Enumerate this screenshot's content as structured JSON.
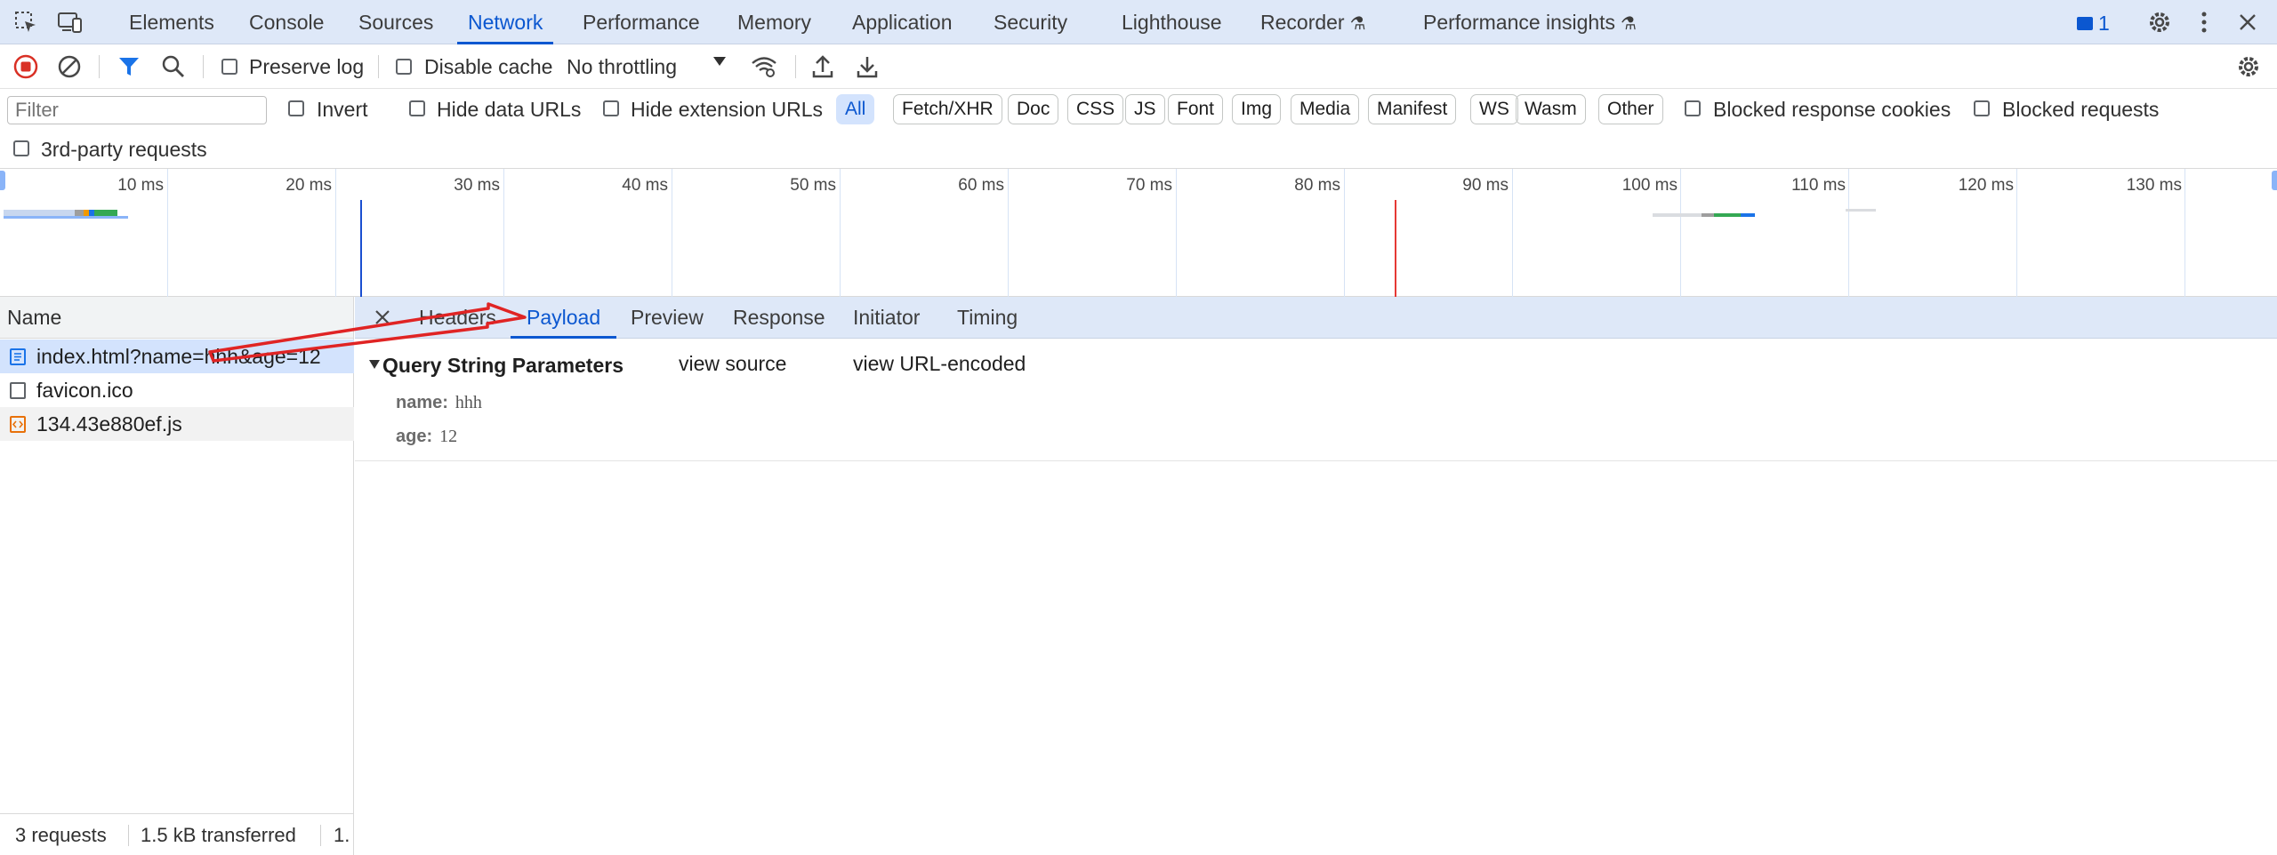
{
  "main_tabs": [
    "Elements",
    "Console",
    "Sources",
    "Network",
    "Performance",
    "Memory",
    "Application",
    "Security",
    "Lighthouse",
    "Recorder",
    "Performance insights"
  ],
  "active_tab": "Network",
  "issues_count": "1",
  "toolbar": {
    "preserve_log": "Preserve log",
    "disable_cache": "Disable cache",
    "throttling": "No throttling"
  },
  "filter": {
    "placeholder": "Filter",
    "invert": "Invert",
    "hide_data_urls": "Hide data URLs",
    "hide_extension_urls": "Hide extension URLs",
    "type_chips": [
      "All",
      "Fetch/XHR",
      "Doc",
      "CSS",
      "JS",
      "Font",
      "Img",
      "Media",
      "Manifest",
      "WS",
      "Wasm",
      "Other"
    ],
    "blocked_response_cookies": "Blocked response cookies",
    "blocked_requests": "Blocked requests",
    "third_party": "3rd-party requests"
  },
  "timeline": {
    "ticks": [
      "10 ms",
      "20 ms",
      "30 ms",
      "40 ms",
      "50 ms",
      "60 ms",
      "70 ms",
      "80 ms",
      "90 ms",
      "100 ms",
      "110 ms",
      "120 ms",
      "130 ms"
    ]
  },
  "requests": {
    "header": "Name",
    "rows": [
      {
        "name": "index.html?name=hhh&age=12",
        "kind": "document"
      },
      {
        "name": "favicon.ico",
        "kind": "other"
      },
      {
        "name": "134.43e880ef.js",
        "kind": "script"
      }
    ],
    "status": {
      "count": "3 requests",
      "transferred": "1.5 kB transferred",
      "resources": "1."
    }
  },
  "detail": {
    "tabs": [
      "Headers",
      "Payload",
      "Preview",
      "Response",
      "Initiator",
      "Timing"
    ],
    "active": "Payload",
    "section_title": "Query String Parameters",
    "view_source": "view source",
    "view_url_encoded": "view URL-encoded",
    "params": [
      {
        "key": "name:",
        "value": "hhh"
      },
      {
        "key": "age:",
        "value": "12"
      }
    ]
  },
  "colors": {
    "accent": "#0b57d0",
    "tabbar_bg": "#dee8f8",
    "record_red": "#d93025",
    "annotation_arrow": "#e02424"
  }
}
